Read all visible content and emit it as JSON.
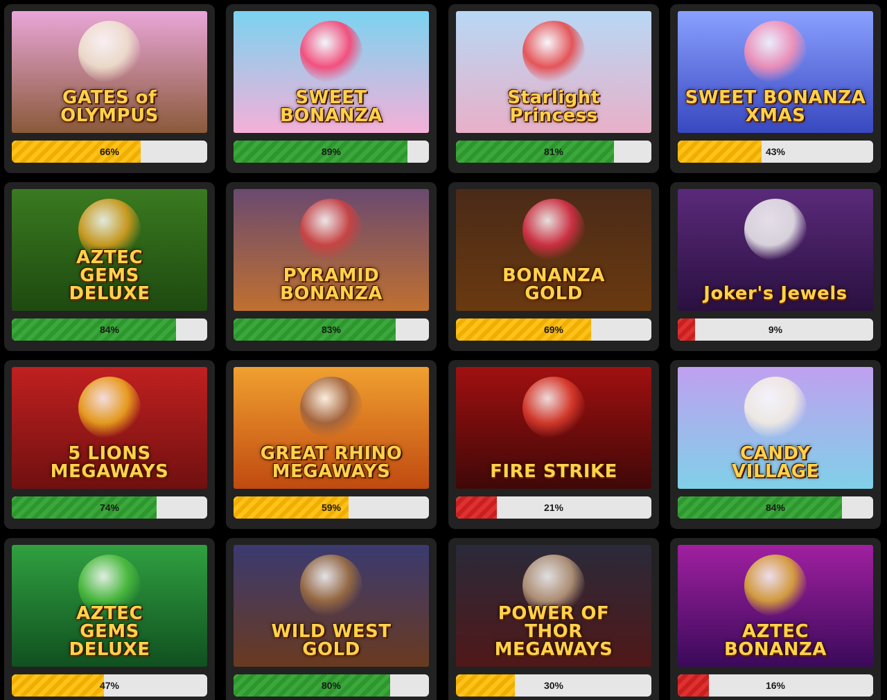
{
  "games": [
    {
      "title": "GATES of OLYMPUS",
      "percent": 66,
      "percent_label": "66%",
      "status": "yellow",
      "bg_top": "#e9a6d8",
      "bg_bottom": "#8a5a3a",
      "emblem": "#f1e6d0"
    },
    {
      "title": "SWEET\nBONANZA",
      "percent": 89,
      "percent_label": "89%",
      "status": "green",
      "bg_top": "#7ad3f0",
      "bg_bottom": "#f5b0d8",
      "emblem": "#ff3b6b"
    },
    {
      "title": "Starlight\nPrincess",
      "percent": 81,
      "percent_label": "81%",
      "status": "green",
      "bg_top": "#b8d8f5",
      "bg_bottom": "#e8b0c8",
      "emblem": "#e84040"
    },
    {
      "title": "SWEET BONANZA XMAS",
      "percent": 43,
      "percent_label": "43%",
      "status": "yellow",
      "bg_top": "#8aa0ff",
      "bg_bottom": "#3848c0",
      "emblem": "#ff90b0"
    },
    {
      "title": "AZTEC\nGEMS\nDELUXE",
      "percent": 84,
      "percent_label": "84%",
      "status": "green",
      "bg_top": "#3a7a20",
      "bg_bottom": "#1e4a10",
      "emblem": "#e0a020"
    },
    {
      "title": "PYRAMID\nBONANZA",
      "percent": 83,
      "percent_label": "83%",
      "status": "green",
      "bg_top": "#6a4a70",
      "bg_bottom": "#c07030",
      "emblem": "#d04040"
    },
    {
      "title": "BONANZA\nGOLD",
      "percent": 69,
      "percent_label": "69%",
      "status": "yellow",
      "bg_top": "#4a2a18",
      "bg_bottom": "#6a3a10",
      "emblem": "#e0304a"
    },
    {
      "title": "Joker's Jewels",
      "percent": 9,
      "percent_label": "9%",
      "status": "red",
      "bg_top": "#5a2a7a",
      "bg_bottom": "#2a1040",
      "emblem": "#f0f0f0"
    },
    {
      "title": "5 LIONS\nMEGAWAYS",
      "percent": 74,
      "percent_label": "74%",
      "status": "green",
      "bg_top": "#c02020",
      "bg_bottom": "#701010",
      "emblem": "#f0b020"
    },
    {
      "title": "GREAT RHINO\nMEGAWAYS",
      "percent": 59,
      "percent_label": "59%",
      "status": "yellow",
      "bg_top": "#f0a030",
      "bg_bottom": "#c04a10",
      "emblem": "#9a6040"
    },
    {
      "title": "FIRE STRIKE",
      "percent": 21,
      "percent_label": "21%",
      "status": "red",
      "bg_top": "#a01010",
      "bg_bottom": "#400808",
      "emblem": "#e04030"
    },
    {
      "title": "CANDY\nVILLAGE",
      "percent": 84,
      "percent_label": "84%",
      "status": "green",
      "bg_top": "#c0a0f0",
      "bg_bottom": "#80d0e8",
      "emblem": "#f8f0e0"
    },
    {
      "title": "AZTEC\nGEMS\nDELUXE",
      "percent": 47,
      "percent_label": "47%",
      "status": "yellow",
      "bg_top": "#30a040",
      "bg_bottom": "#105020",
      "emblem": "#50c040"
    },
    {
      "title": "WILD WEST\nGOLD",
      "percent": 80,
      "percent_label": "80%",
      "status": "green",
      "bg_top": "#3a3a70",
      "bg_bottom": "#6a3a20",
      "emblem": "#a07040"
    },
    {
      "title": "POWER OF\nTHOR\nMEGAWAYS",
      "percent": 30,
      "percent_label": "30%",
      "status": "yellow",
      "bg_top": "#2a2a3a",
      "bg_bottom": "#501818",
      "emblem": "#c0a080"
    },
    {
      "title": "AZTEC\nBONANZA",
      "percent": 16,
      "percent_label": "16%",
      "status": "red",
      "bg_top": "#a020a0",
      "bg_bottom": "#3a0a5a",
      "emblem": "#e0b030"
    }
  ]
}
